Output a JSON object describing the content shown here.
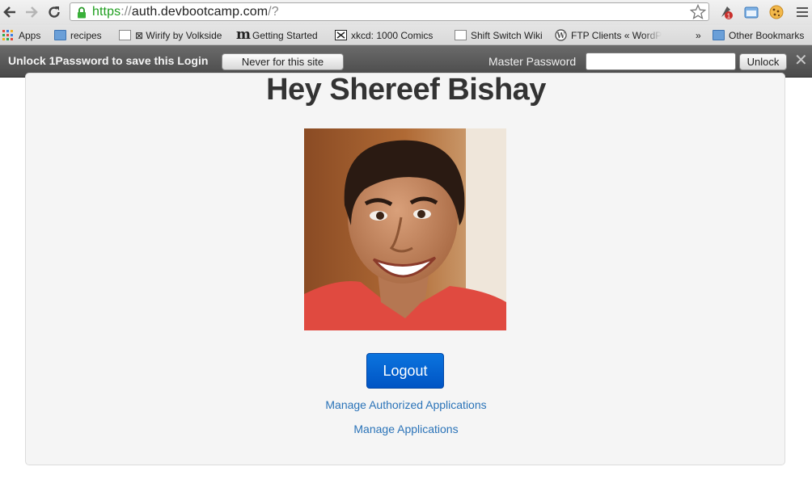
{
  "browser": {
    "url_scheme": "https",
    "url_separator": "://",
    "url_host": "auth.devbootcamp.com",
    "url_path": "/?"
  },
  "bookmarks": [
    {
      "label": "Apps",
      "icon": "apps-grid-icon"
    },
    {
      "label": "recipes",
      "icon": "folder-icon"
    },
    {
      "label": "⊠ Wirify by Volkside",
      "icon": "page-icon"
    },
    {
      "label": "Getting Started",
      "icon": "m-logo-icon"
    },
    {
      "label": "xkcd: 1000 Comics",
      "icon": "xkcd-icon"
    },
    {
      "label": "Shift Switch Wiki",
      "icon": "page-icon"
    },
    {
      "label": "FTP Clients « WordPr",
      "icon": "wordpress-icon"
    },
    {
      "label": "»",
      "icon": ""
    },
    {
      "label": "Other Bookmarks",
      "icon": "folder-icon"
    }
  ],
  "onepassword": {
    "prompt": "Unlock 1Password to save this Login",
    "never_label": "Never for this site",
    "master_label": "Master Password",
    "password_value": "",
    "unlock_label": "Unlock",
    "close_glyph": "✕"
  },
  "page": {
    "greeting": "Hey Shereef Bishay",
    "logout_label": "Logout",
    "link_authorized": "Manage Authorized Applications",
    "link_applications": "Manage Applications"
  }
}
